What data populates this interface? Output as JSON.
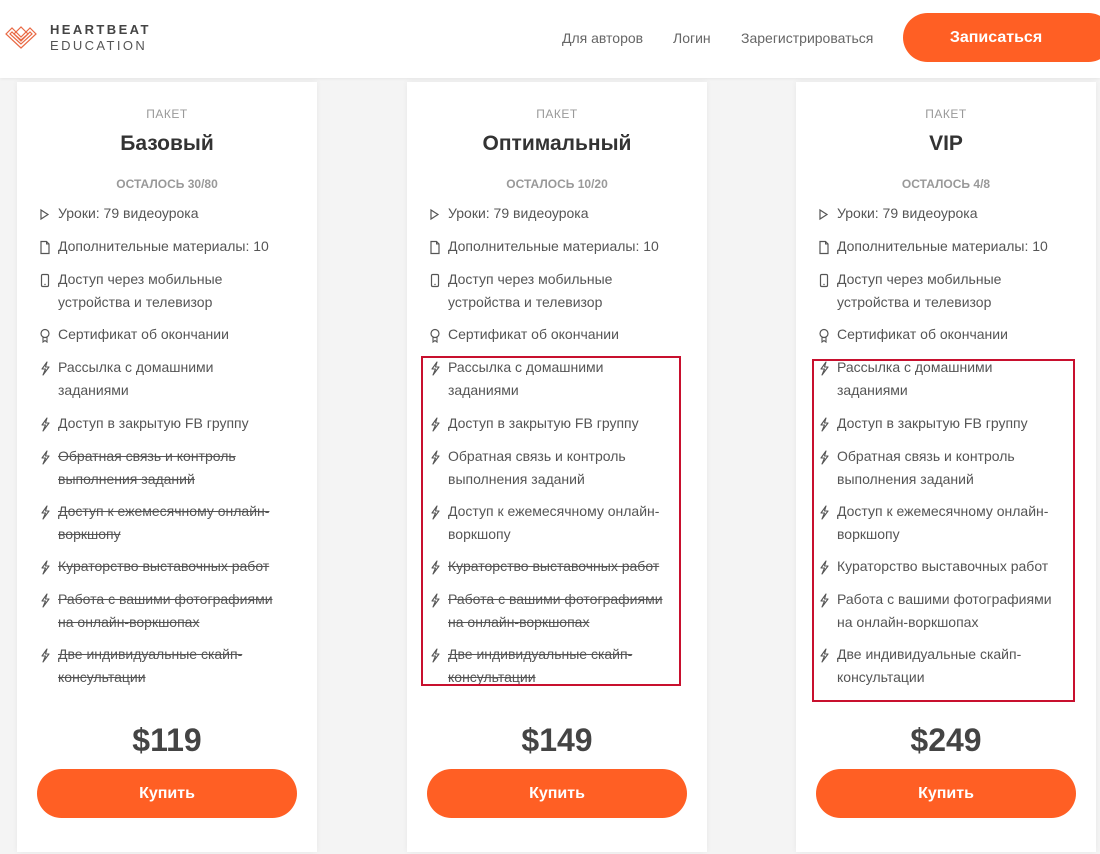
{
  "header": {
    "logo_line1": "HEARTBEAT",
    "logo_line2": "EDUCATION",
    "nav": [
      "Для авторов",
      "Логин",
      "Зарегистрироваться"
    ],
    "signup_label": "Записаться",
    "accent_color": "#ff5f24"
  },
  "icons": {
    "lesson": "play-icon",
    "materials": "document-icon",
    "mobile": "phone-icon",
    "certificate": "award-icon",
    "extra": "lightning-icon"
  },
  "plans": [
    {
      "kicker": "ПАКЕТ",
      "name": "Базовый",
      "remaining": "ОСТАЛОСЬ 30/80",
      "features": [
        {
          "icon": "play-icon",
          "text": "Уроки: 79 видеоурока",
          "included": true
        },
        {
          "icon": "document-icon",
          "text": "Дополнительные материалы: 10",
          "included": true
        },
        {
          "icon": "phone-icon",
          "text": "Доступ через мобильные устройства и телевизор",
          "included": true
        },
        {
          "icon": "award-icon",
          "text": "Сертификат об окончании",
          "included": true
        },
        {
          "icon": "lightning-icon",
          "text": "Рассылка с домашними заданиями",
          "included": true
        },
        {
          "icon": "lightning-icon",
          "text": "Доступ в закрытую FB группу",
          "included": true
        },
        {
          "icon": "lightning-icon",
          "text": "Обратная связь и контроль выполнения заданий",
          "included": false
        },
        {
          "icon": "lightning-icon",
          "text": "Доступ к ежемесячному онлайн-воркшопу",
          "included": false
        },
        {
          "icon": "lightning-icon",
          "text": "Кураторство выставочных работ",
          "included": false
        },
        {
          "icon": "lightning-icon",
          "text": "Работа с вашими фотографиями на онлайн-воркшопах",
          "included": false
        },
        {
          "icon": "lightning-icon",
          "text": "Две индивидуальные скайп-консультации",
          "included": false
        }
      ],
      "price": "$119",
      "buy_label": "Купить"
    },
    {
      "kicker": "ПАКЕТ",
      "name": "Оптимальный",
      "remaining": "ОСТАЛОСЬ 10/20",
      "features": [
        {
          "icon": "play-icon",
          "text": "Уроки: 79 видеоурока",
          "included": true
        },
        {
          "icon": "document-icon",
          "text": "Дополнительные материалы: 10",
          "included": true
        },
        {
          "icon": "phone-icon",
          "text": "Доступ через мобильные устройства и телевизор",
          "included": true
        },
        {
          "icon": "award-icon",
          "text": "Сертификат об окончании",
          "included": true
        },
        {
          "icon": "lightning-icon",
          "text": "Рассылка с домашними заданиями",
          "included": true
        },
        {
          "icon": "lightning-icon",
          "text": "Доступ в закрытую FB группу",
          "included": true
        },
        {
          "icon": "lightning-icon",
          "text": "Обратная связь и контроль выполнения заданий",
          "included": true
        },
        {
          "icon": "lightning-icon",
          "text": "Доступ к ежемесячному онлайн-воркшопу",
          "included": true
        },
        {
          "icon": "lightning-icon",
          "text": "Кураторство выставочных работ",
          "included": false
        },
        {
          "icon": "lightning-icon",
          "text": "Работа с вашими фотографиями на онлайн-воркшопах",
          "included": false
        },
        {
          "icon": "lightning-icon",
          "text": "Две индивидуальные скайп-консультации",
          "included": false
        }
      ],
      "price": "$149",
      "buy_label": "Купить"
    },
    {
      "kicker": "ПАКЕТ",
      "name": "VIP",
      "remaining": "ОСТАЛОСЬ 4/8",
      "features": [
        {
          "icon": "play-icon",
          "text": "Уроки: 79 видеоурока",
          "included": true
        },
        {
          "icon": "document-icon",
          "text": "Дополнительные материалы: 10",
          "included": true
        },
        {
          "icon": "phone-icon",
          "text": "Доступ через мобильные устройства и телевизор",
          "included": true
        },
        {
          "icon": "award-icon",
          "text": "Сертификат об окончании",
          "included": true
        },
        {
          "icon": "lightning-icon",
          "text": "Рассылка с домашними заданиями",
          "included": true
        },
        {
          "icon": "lightning-icon",
          "text": "Доступ в закрытую FB группу",
          "included": true
        },
        {
          "icon": "lightning-icon",
          "text": "Обратная связь и контроль выполнения заданий",
          "included": true
        },
        {
          "icon": "lightning-icon",
          "text": "Доступ к ежемесячному онлайн-воркшопу",
          "included": true
        },
        {
          "icon": "lightning-icon",
          "text": "Кураторство выставочных работ",
          "included": true
        },
        {
          "icon": "lightning-icon",
          "text": "Работа с вашими фотографиями на онлайн-воркшопах",
          "included": true
        },
        {
          "icon": "lightning-icon",
          "text": "Две индивидуальные скайп-консультации",
          "included": true
        }
      ],
      "price": "$249",
      "buy_label": "Купить"
    }
  ],
  "highlight_color": "#c8102e"
}
